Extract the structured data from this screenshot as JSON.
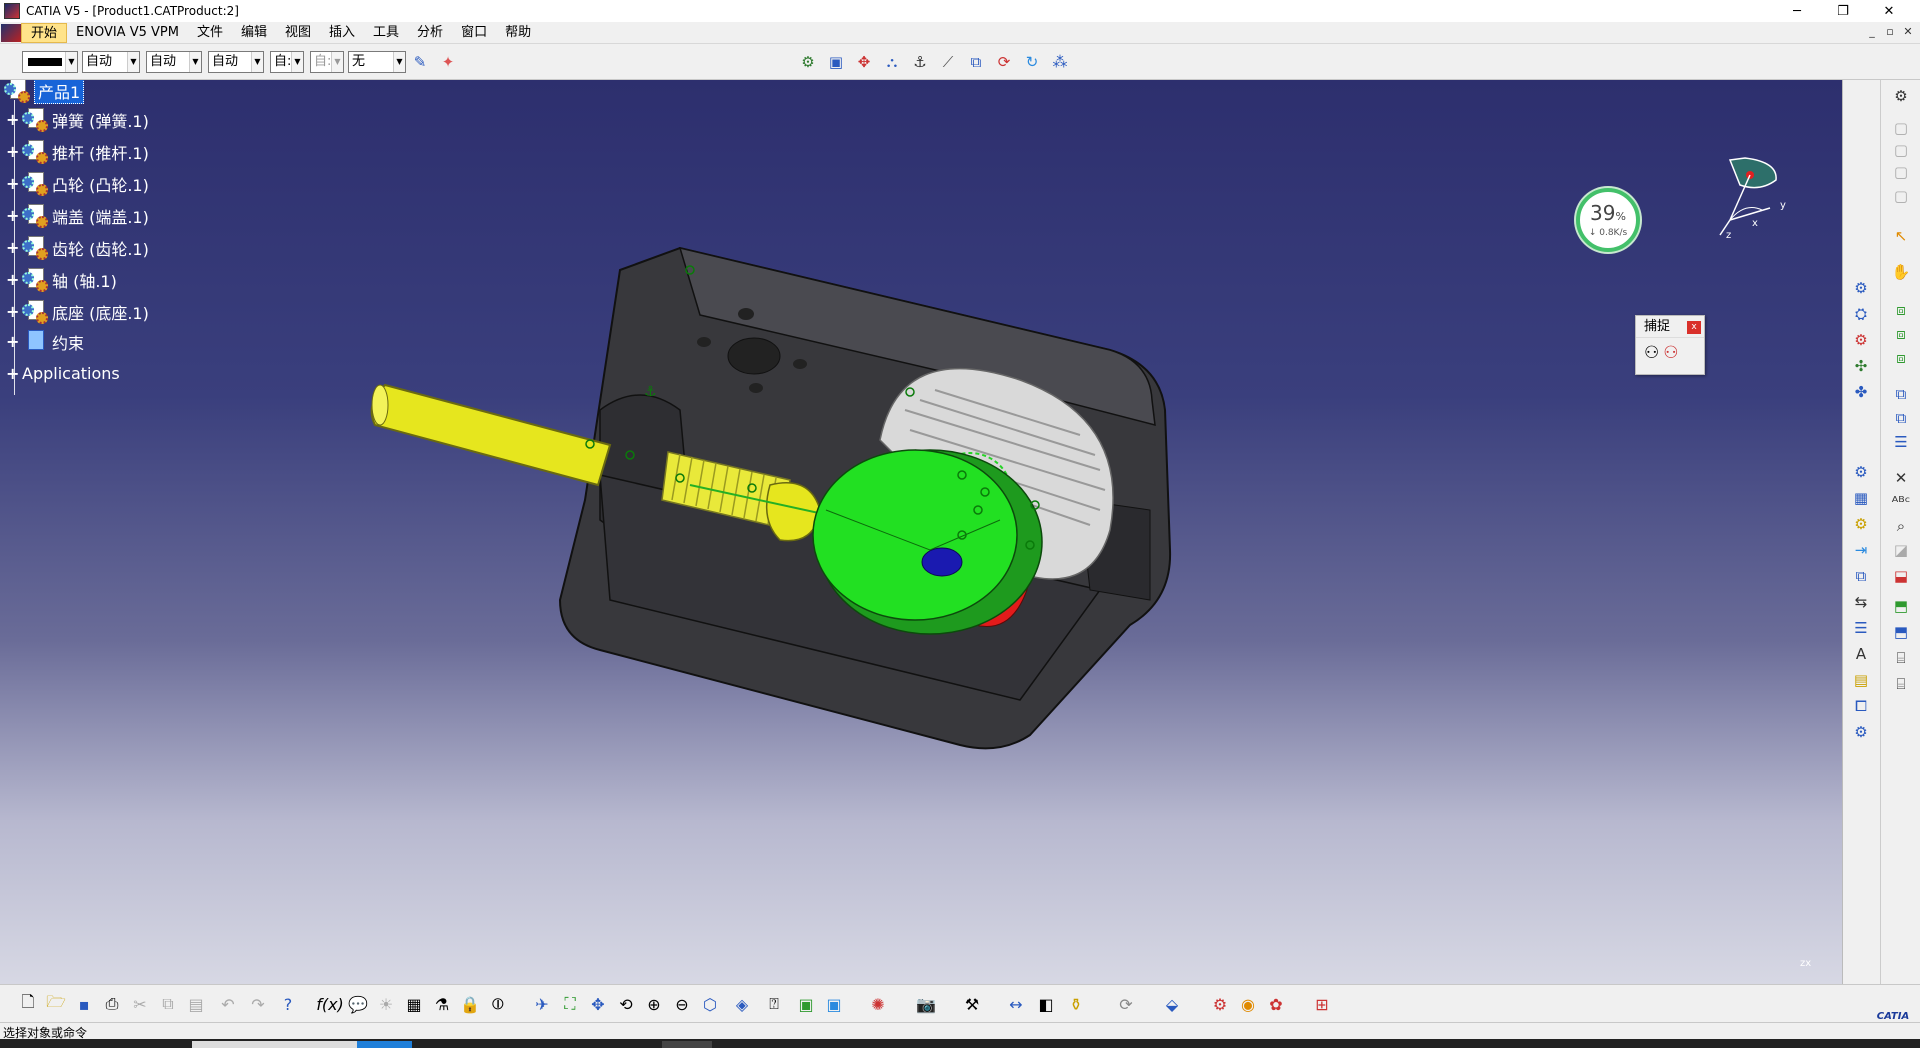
{
  "window": {
    "title": "CATIA V5 - [Product1.CATProduct:2]",
    "controls": {
      "minimize": "─",
      "restore": "❐",
      "close": "✕"
    }
  },
  "menubar": {
    "items": [
      "开始",
      "ENOVIA V5 VPM",
      "文件",
      "编辑",
      "视图",
      "插入",
      "工具",
      "分析",
      "窗口",
      "帮助"
    ],
    "active_index": 0,
    "mdi_controls": {
      "minimize": "_",
      "restore": "▫",
      "close": "✕"
    }
  },
  "graphic_properties": {
    "color_value": "",
    "linetype": "自动",
    "thickness": "自动",
    "lineweight": "自动",
    "point": "自:",
    "layer_value": "自:",
    "layer": "无"
  },
  "tree": {
    "root": "产品1",
    "children": [
      {
        "label": "弹簧 (弹簧.1)"
      },
      {
        "label": "推杆 (推杆.1)"
      },
      {
        "label": "凸轮 (凸轮.1)"
      },
      {
        "label": "端盖 (端盖.1)"
      },
      {
        "label": "齿轮 (齿轮.1)"
      },
      {
        "label": "轴 (轴.1)"
      },
      {
        "label": "底座 (底座.1)"
      },
      {
        "label": "约束"
      },
      {
        "label": "Applications"
      }
    ]
  },
  "speed_widget": {
    "percent": "39",
    "percent_unit": "%",
    "rate": "↓ 0.8K/s"
  },
  "compass": {
    "axis_x": "x",
    "axis_y": "y",
    "axis_z": "z"
  },
  "capture_panel": {
    "title": "捕捉",
    "close": "x"
  },
  "mini_axis": {
    "label": "zx"
  },
  "catia_logo": "CATIA",
  "statusbar": {
    "message": "选择对象或命令"
  },
  "colors": {
    "viewport_top": "#2d2f6e",
    "viewport_bottom": "#d7d8e4",
    "selected_tree": "#1864d8",
    "cam_green": "#22e022",
    "shaft_yellow": "#e6e61e",
    "base_dark": "#3a3a3e"
  }
}
